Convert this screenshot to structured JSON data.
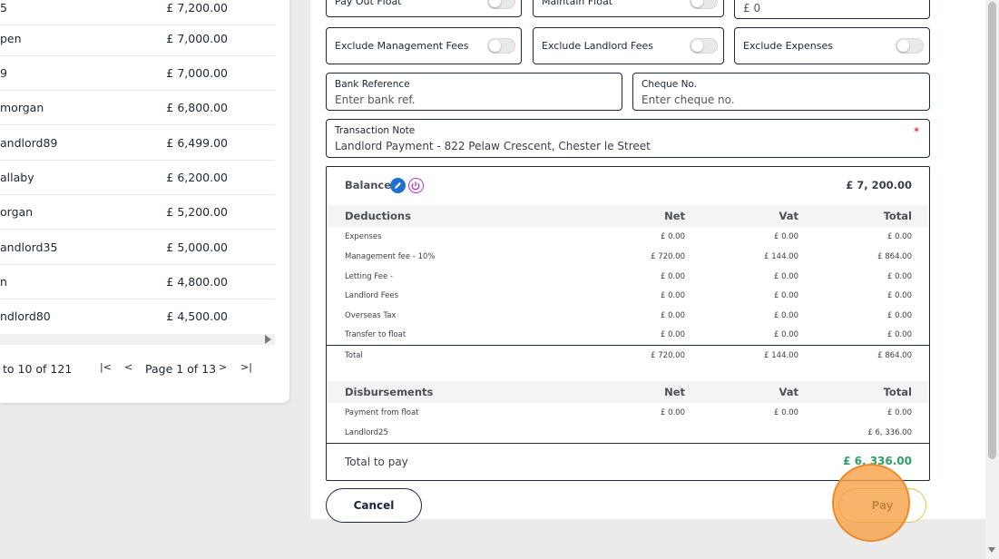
{
  "landlord_list": {
    "rows": [
      {
        "name": "5",
        "amount": "£ 7,200.00"
      },
      {
        "name": "pen",
        "amount": "£ 7,000.00"
      },
      {
        "name": "9",
        "amount": "£ 7,000.00"
      },
      {
        "name": " morgan",
        "amount": "£ 6,800.00"
      },
      {
        "name": "andlord89",
        "amount": "£ 6,499.00"
      },
      {
        "name": "allaby",
        "amount": "£ 6,200.00"
      },
      {
        "name": "organ",
        "amount": "£ 5,200.00"
      },
      {
        "name": "andlord35",
        "amount": "£ 5,000.00"
      },
      {
        "name": "n",
        "amount": "£ 4,800.00"
      },
      {
        "name": "ndlord80",
        "amount": "£ 4,500.00"
      }
    ],
    "pager": {
      "count": "to 10 of 121",
      "first": "|<",
      "prev": "<",
      "label": "Page 1 of 13",
      "next": ">",
      "last": ">|"
    }
  },
  "form": {
    "top_partial": {
      "left_label": "Pay Out Float",
      "mid_label": "Maintain Float",
      "amount_value": "£ 0"
    },
    "toggles": {
      "exclude_management_fees": "Exclude Management Fees",
      "exclude_landlord_fees": "Exclude Landlord Fees",
      "exclude_expenses": "Exclude Expenses"
    },
    "bank_reference": {
      "label": "Bank Reference",
      "placeholder": "Enter bank ref."
    },
    "cheque_no": {
      "label": "Cheque No.",
      "placeholder": "Enter cheque no."
    },
    "transaction_note": {
      "label": "Transaction Note",
      "required_mark": "*",
      "value": "Landlord Payment - 822 Pelaw Crescent, Chester le Street"
    }
  },
  "summary": {
    "balance_label": "Balance",
    "balance_value": "£ 7, 200.00",
    "deductions": {
      "title": "Deductions",
      "columns": [
        "Net",
        "Vat",
        "Total"
      ],
      "rows": [
        {
          "label": "Expenses",
          "net": "£ 0.00",
          "vat": "£ 0.00",
          "total": "£ 0.00"
        },
        {
          "label": "Management fee - 10%",
          "net": "£ 720.00",
          "vat": "£ 144.00",
          "total": "£ 864.00"
        },
        {
          "label": "Letting Fee -",
          "net": "£ 0.00",
          "vat": "£ 0.00",
          "total": "£ 0.00"
        },
        {
          "label": "Landlord Fees",
          "net": "£ 0.00",
          "vat": "£ 0.00",
          "total": "£ 0.00"
        },
        {
          "label": "Overseas Tax",
          "net": "£ 0.00",
          "vat": "£ 0.00",
          "total": "£ 0.00"
        },
        {
          "label": "Transfer to float",
          "net": "£ 0.00",
          "vat": "£ 0.00",
          "total": "£ 0.00"
        }
      ],
      "total_row": {
        "label": "Total",
        "net": "£ 720.00",
        "vat": "£ 144.00",
        "total": "£ 864.00"
      }
    },
    "disbursements": {
      "title": "Disbursements",
      "columns": [
        "Net",
        "Vat",
        "Total"
      ],
      "rows": [
        {
          "label": "Payment from float",
          "net": "£ 0.00",
          "vat": "£ 0.00",
          "total": "£ 0.00"
        },
        {
          "label": "Landlord25",
          "net": "",
          "vat": "",
          "total": "£ 6, 336.00"
        }
      ]
    },
    "total_to_pay_label": "Total to pay",
    "total_to_pay_value": "£ 6, 336.00"
  },
  "actions": {
    "cancel": "Cancel",
    "pay": "Pay"
  },
  "colors": {
    "accent_green": "#2e9e6a",
    "highlight_orange": "#f79f42",
    "edit_icon_blue": "#1e6fd0",
    "power_icon_magenta": "#b03ac2",
    "pay_border": "#f0c24a"
  },
  "icons": {
    "edit": "pencil-icon",
    "power": "power-icon"
  }
}
